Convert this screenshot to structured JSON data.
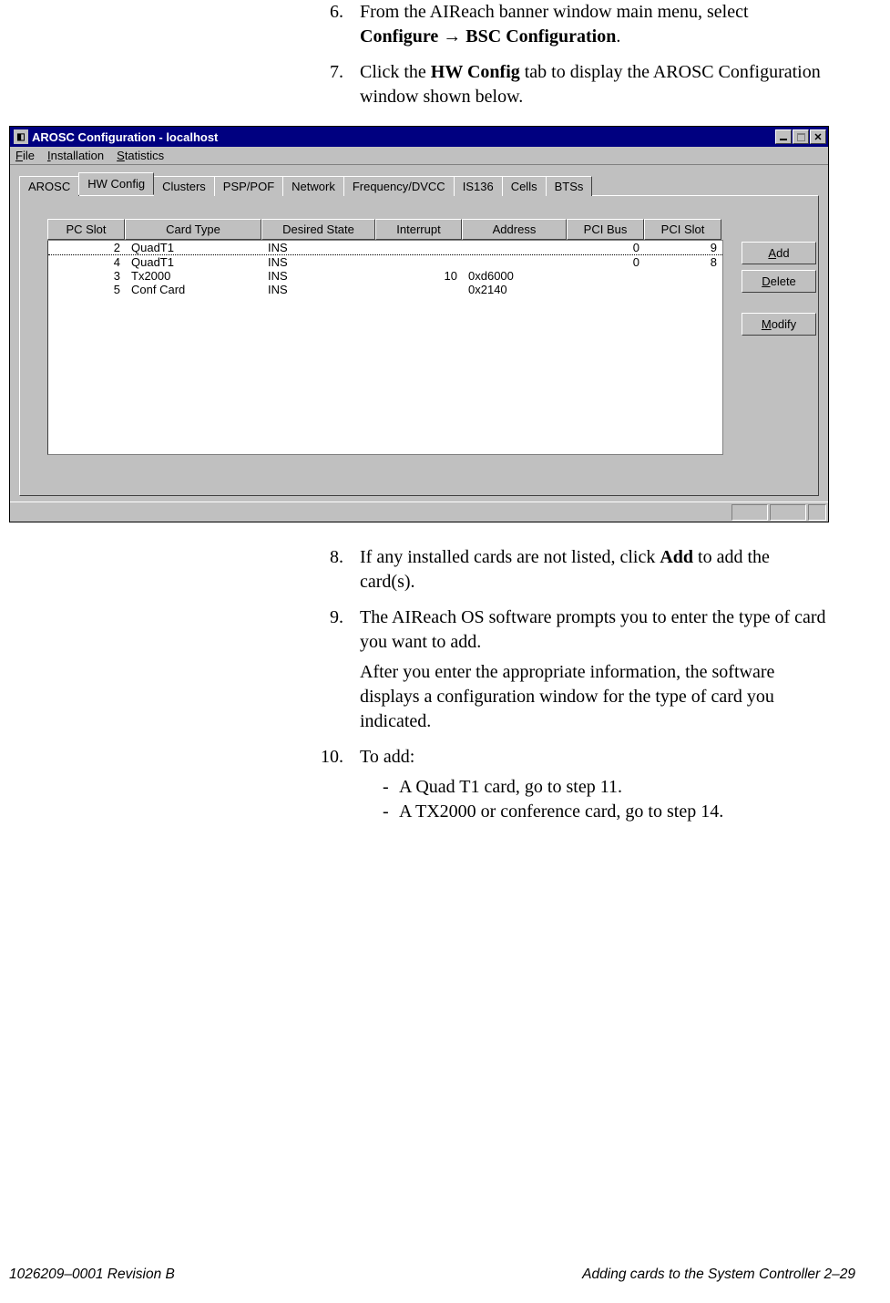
{
  "steps_top": [
    {
      "num": "6.",
      "lines": [
        {
          "pre": "From the AIReach banner window main menu, select ",
          "bold": "Configure → BSC Configuration",
          "post": "."
        }
      ]
    },
    {
      "num": "7.",
      "lines": [
        {
          "pre": "Click the ",
          "bold": "HW Config",
          "post": " tab to display the AROSC Configuration window shown below."
        }
      ]
    }
  ],
  "window": {
    "title": "AROSC Configuration - localhost",
    "menus": [
      {
        "u": "F",
        "rest": "ile"
      },
      {
        "u": "I",
        "rest": "nstallation"
      },
      {
        "u": "S",
        "rest": "tatistics"
      }
    ],
    "tabs": [
      "AROSC",
      "HW Config",
      "Clusters",
      "PSP/POF",
      "Network",
      "Frequency/DVCC",
      "IS136",
      "Cells",
      "BTSs"
    ],
    "active_tab": "HW Config",
    "columns": [
      "PC Slot",
      "Card Type",
      "Desired State",
      "Interrupt",
      "Address",
      "PCI Bus",
      "PCI Slot"
    ],
    "rows": [
      {
        "slot": "2",
        "type": "QuadT1",
        "state": "INS",
        "intr": "",
        "addr": "",
        "bus": "0",
        "pslot": "9",
        "dotted": true
      },
      {
        "slot": "4",
        "type": "QuadT1",
        "state": "INS",
        "intr": "",
        "addr": "",
        "bus": "0",
        "pslot": "8"
      },
      {
        "slot": "3",
        "type": "Tx2000",
        "state": "INS",
        "intr": "10",
        "addr": "0xd6000",
        "bus": "",
        "pslot": ""
      },
      {
        "slot": "5",
        "type": "Conf Card",
        "state": "INS",
        "intr": "",
        "addr": "0x2140",
        "bus": "",
        "pslot": ""
      }
    ],
    "buttons": [
      {
        "u": "A",
        "rest": "dd"
      },
      {
        "u": "D",
        "rest": "elete"
      },
      {
        "u": "M",
        "rest": "odify"
      }
    ]
  },
  "steps_bottom": [
    {
      "num": "8.",
      "paras": [
        {
          "pre": "If any installed cards are not listed, click ",
          "bold": "Add",
          "post": " to add the card(s)."
        }
      ]
    },
    {
      "num": "9.",
      "paras": [
        {
          "text": "The AIReach OS software prompts you to enter the type of card you want to add."
        },
        {
          "text": "After you enter the appropriate information, the software displays a configuration window for the type of card you indicated."
        }
      ]
    },
    {
      "num": "10.",
      "paras": [
        {
          "text": "To add:"
        }
      ],
      "subs": [
        "A Quad T1 card, go to step 11.",
        "A TX2000 or conference card, go to step 14."
      ]
    }
  ],
  "footer": {
    "left": "1026209–0001  Revision B",
    "right": "Adding cards to the System Controller   2–29"
  }
}
